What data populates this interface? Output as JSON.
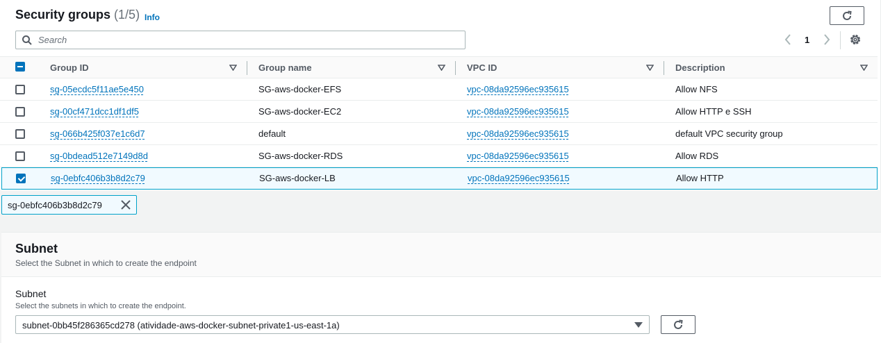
{
  "security_groups": {
    "title": "Security groups",
    "count": "(1/5)",
    "info_label": "Info",
    "search_placeholder": "Search",
    "page_number": "1",
    "columns": [
      "Group ID",
      "Group name",
      "VPC ID",
      "Description"
    ],
    "rows": [
      {
        "group_id": "sg-05ecdc5f11ae5e450",
        "group_name": "SG-aws-docker-EFS",
        "vpc_id": "vpc-08da92596ec935615",
        "description": "Allow NFS",
        "selected": false
      },
      {
        "group_id": "sg-00cf471dcc1df1df5",
        "group_name": "SG-aws-docker-EC2",
        "vpc_id": "vpc-08da92596ec935615",
        "description": "Allow HTTP e SSH",
        "selected": false
      },
      {
        "group_id": "sg-066b425f037e1c6d7",
        "group_name": "default",
        "vpc_id": "vpc-08da92596ec935615",
        "description": "default VPC security group",
        "selected": false
      },
      {
        "group_id": "sg-0bdead512e7149d8d",
        "group_name": "SG-aws-docker-RDS",
        "vpc_id": "vpc-08da92596ec935615",
        "description": "Allow RDS",
        "selected": false
      },
      {
        "group_id": "sg-0ebfc406b3b8d2c79",
        "group_name": "SG-aws-docker-LB",
        "vpc_id": "vpc-08da92596ec935615",
        "description": "Allow HTTP",
        "selected": true
      }
    ],
    "selected_token": "sg-0ebfc406b3b8d2c79"
  },
  "subnet": {
    "title": "Subnet",
    "description": "Select the Subnet in which to create the endpoint",
    "field_label": "Subnet",
    "field_description": "Select the subnets in which to create the endpoint.",
    "selected_value": "subnet-0bb45f286365cd278 (atividade-aws-docker-subnet-private1-us-east-1a)"
  },
  "icons": [
    "refresh-icon",
    "search-icon",
    "chevron-left-icon",
    "chevron-right-icon",
    "settings-gear-icon",
    "sort-caret-icon",
    "close-icon",
    "caret-down-icon"
  ],
  "colors": {
    "link": "#0073bb",
    "selected_border": "#00a1c9",
    "selected_bg": "#f1faff"
  }
}
